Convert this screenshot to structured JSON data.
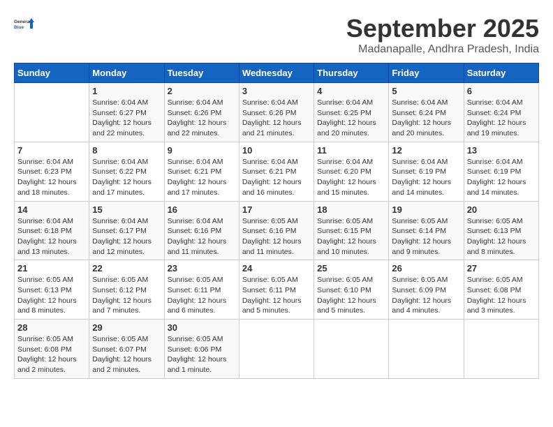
{
  "header": {
    "logo": {
      "general": "General",
      "blue": "Blue"
    },
    "month": "September 2025",
    "location": "Madanapalle, Andhra Pradesh, India"
  },
  "weekdays": [
    "Sunday",
    "Monday",
    "Tuesday",
    "Wednesday",
    "Thursday",
    "Friday",
    "Saturday"
  ],
  "weeks": [
    [
      {
        "day": "",
        "info": ""
      },
      {
        "day": "1",
        "info": "Sunrise: 6:04 AM\nSunset: 6:27 PM\nDaylight: 12 hours\nand 22 minutes."
      },
      {
        "day": "2",
        "info": "Sunrise: 6:04 AM\nSunset: 6:26 PM\nDaylight: 12 hours\nand 22 minutes."
      },
      {
        "day": "3",
        "info": "Sunrise: 6:04 AM\nSunset: 6:26 PM\nDaylight: 12 hours\nand 21 minutes."
      },
      {
        "day": "4",
        "info": "Sunrise: 6:04 AM\nSunset: 6:25 PM\nDaylight: 12 hours\nand 20 minutes."
      },
      {
        "day": "5",
        "info": "Sunrise: 6:04 AM\nSunset: 6:24 PM\nDaylight: 12 hours\nand 20 minutes."
      },
      {
        "day": "6",
        "info": "Sunrise: 6:04 AM\nSunset: 6:24 PM\nDaylight: 12 hours\nand 19 minutes."
      }
    ],
    [
      {
        "day": "7",
        "info": "Sunrise: 6:04 AM\nSunset: 6:23 PM\nDaylight: 12 hours\nand 18 minutes."
      },
      {
        "day": "8",
        "info": "Sunrise: 6:04 AM\nSunset: 6:22 PM\nDaylight: 12 hours\nand 17 minutes."
      },
      {
        "day": "9",
        "info": "Sunrise: 6:04 AM\nSunset: 6:21 PM\nDaylight: 12 hours\nand 17 minutes."
      },
      {
        "day": "10",
        "info": "Sunrise: 6:04 AM\nSunset: 6:21 PM\nDaylight: 12 hours\nand 16 minutes."
      },
      {
        "day": "11",
        "info": "Sunrise: 6:04 AM\nSunset: 6:20 PM\nDaylight: 12 hours\nand 15 minutes."
      },
      {
        "day": "12",
        "info": "Sunrise: 6:04 AM\nSunset: 6:19 PM\nDaylight: 12 hours\nand 14 minutes."
      },
      {
        "day": "13",
        "info": "Sunrise: 6:04 AM\nSunset: 6:19 PM\nDaylight: 12 hours\nand 14 minutes."
      }
    ],
    [
      {
        "day": "14",
        "info": "Sunrise: 6:04 AM\nSunset: 6:18 PM\nDaylight: 12 hours\nand 13 minutes."
      },
      {
        "day": "15",
        "info": "Sunrise: 6:04 AM\nSunset: 6:17 PM\nDaylight: 12 hours\nand 12 minutes."
      },
      {
        "day": "16",
        "info": "Sunrise: 6:04 AM\nSunset: 6:16 PM\nDaylight: 12 hours\nand 11 minutes."
      },
      {
        "day": "17",
        "info": "Sunrise: 6:05 AM\nSunset: 6:16 PM\nDaylight: 12 hours\nand 11 minutes."
      },
      {
        "day": "18",
        "info": "Sunrise: 6:05 AM\nSunset: 6:15 PM\nDaylight: 12 hours\nand 10 minutes."
      },
      {
        "day": "19",
        "info": "Sunrise: 6:05 AM\nSunset: 6:14 PM\nDaylight: 12 hours\nand 9 minutes."
      },
      {
        "day": "20",
        "info": "Sunrise: 6:05 AM\nSunset: 6:13 PM\nDaylight: 12 hours\nand 8 minutes."
      }
    ],
    [
      {
        "day": "21",
        "info": "Sunrise: 6:05 AM\nSunset: 6:13 PM\nDaylight: 12 hours\nand 8 minutes."
      },
      {
        "day": "22",
        "info": "Sunrise: 6:05 AM\nSunset: 6:12 PM\nDaylight: 12 hours\nand 7 minutes."
      },
      {
        "day": "23",
        "info": "Sunrise: 6:05 AM\nSunset: 6:11 PM\nDaylight: 12 hours\nand 6 minutes."
      },
      {
        "day": "24",
        "info": "Sunrise: 6:05 AM\nSunset: 6:11 PM\nDaylight: 12 hours\nand 5 minutes."
      },
      {
        "day": "25",
        "info": "Sunrise: 6:05 AM\nSunset: 6:10 PM\nDaylight: 12 hours\nand 5 minutes."
      },
      {
        "day": "26",
        "info": "Sunrise: 6:05 AM\nSunset: 6:09 PM\nDaylight: 12 hours\nand 4 minutes."
      },
      {
        "day": "27",
        "info": "Sunrise: 6:05 AM\nSunset: 6:08 PM\nDaylight: 12 hours\nand 3 minutes."
      }
    ],
    [
      {
        "day": "28",
        "info": "Sunrise: 6:05 AM\nSunset: 6:08 PM\nDaylight: 12 hours\nand 2 minutes."
      },
      {
        "day": "29",
        "info": "Sunrise: 6:05 AM\nSunset: 6:07 PM\nDaylight: 12 hours\nand 2 minutes."
      },
      {
        "day": "30",
        "info": "Sunrise: 6:05 AM\nSunset: 6:06 PM\nDaylight: 12 hours\nand 1 minute."
      },
      {
        "day": "",
        "info": ""
      },
      {
        "day": "",
        "info": ""
      },
      {
        "day": "",
        "info": ""
      },
      {
        "day": "",
        "info": ""
      }
    ]
  ]
}
